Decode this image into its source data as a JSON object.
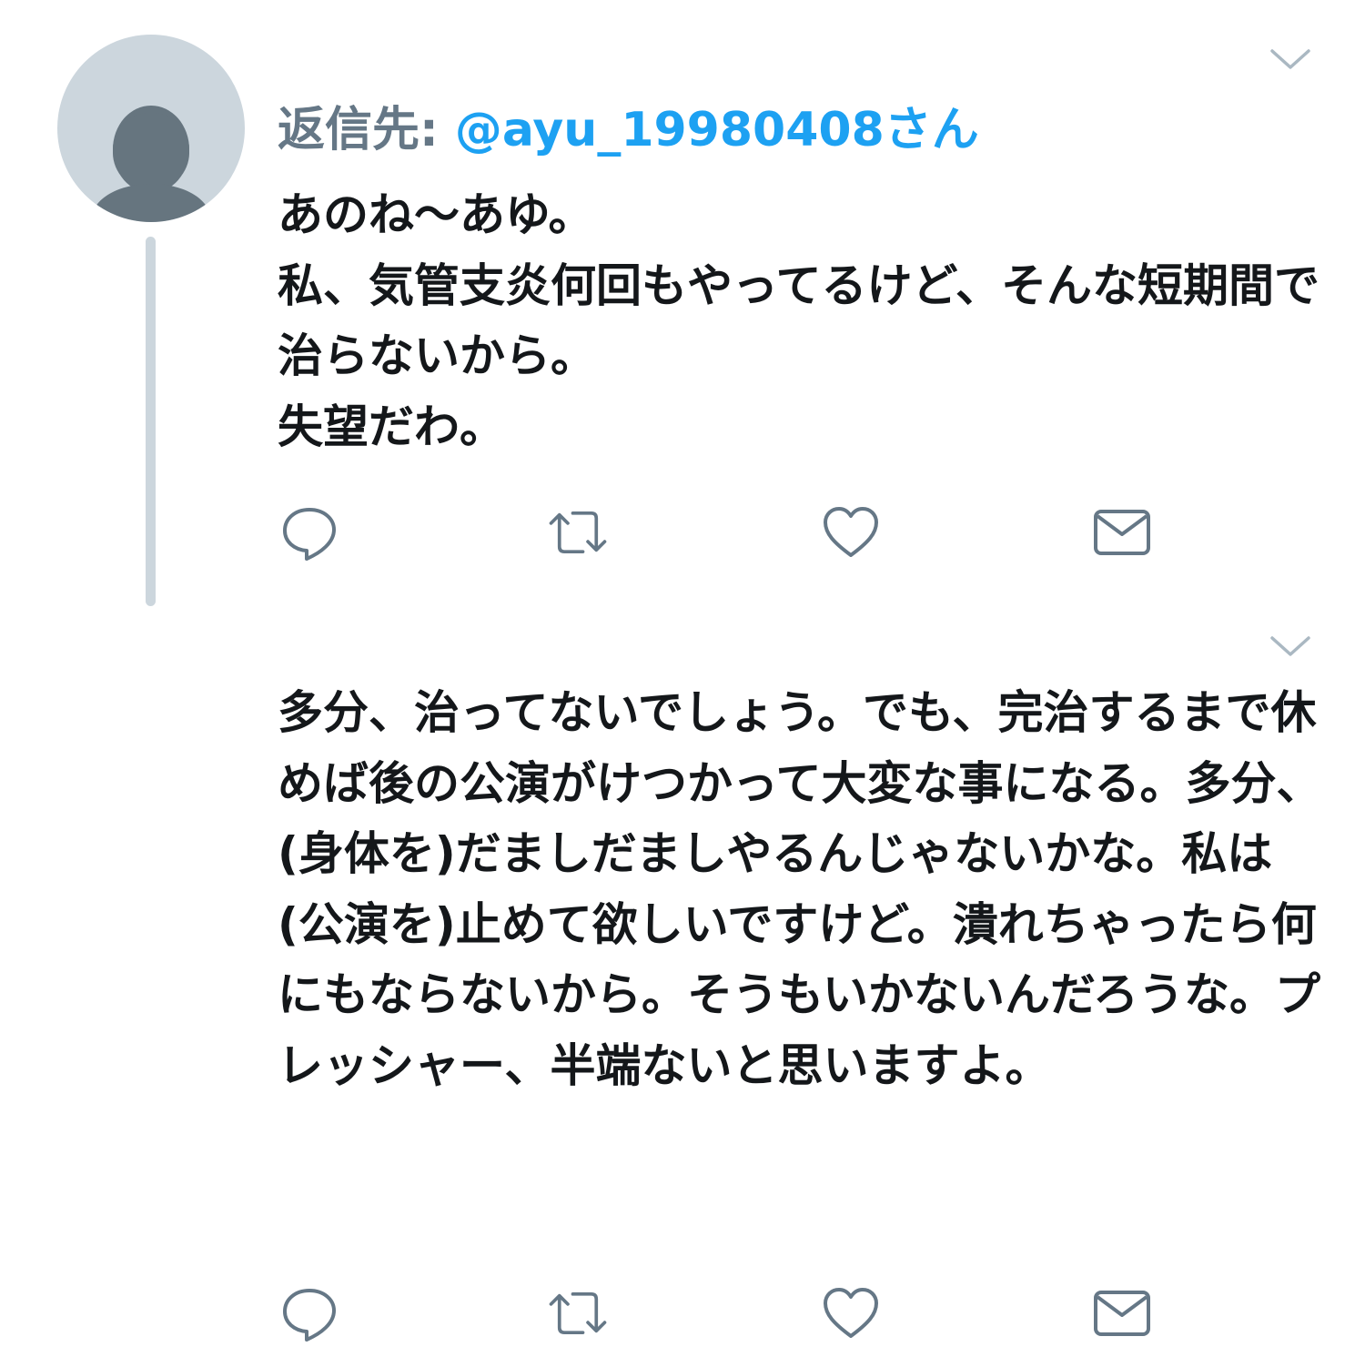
{
  "tweets": [
    {
      "reply_prefix": "返信先: ",
      "reply_handle": "@ayu_19980408さん",
      "text": "あのね〜あゆ。\n私、気管支炎何回もやってるけど、そんな短期間で治らないから。\n失望だわ。"
    },
    {
      "text": "多分、治ってないでしょう。でも、完治するまで休めば後の公演がけつかって大変な事になる。多分、(身体を)だましだましやるんじゃないかな。私は(公演を)止めて欲しいですけど。潰れちゃったら何にもならないから。そうもいかないんだろうな。プレッシャー、半端ないと思いますよ。"
    }
  ],
  "icons": {
    "caret": "chevron-down-icon",
    "reply": "reply-icon",
    "retweet": "retweet-icon",
    "like": "heart-icon",
    "dm": "envelope-icon",
    "avatar": "default-profile-icon"
  },
  "colors": {
    "icon": "#657786",
    "link": "#1da1f2",
    "text": "#14171a",
    "avatar_bg": "#ccd6dd",
    "avatar_fg": "#66757f",
    "thread_line": "#ccd6dd",
    "caret": "#aab8c2"
  }
}
